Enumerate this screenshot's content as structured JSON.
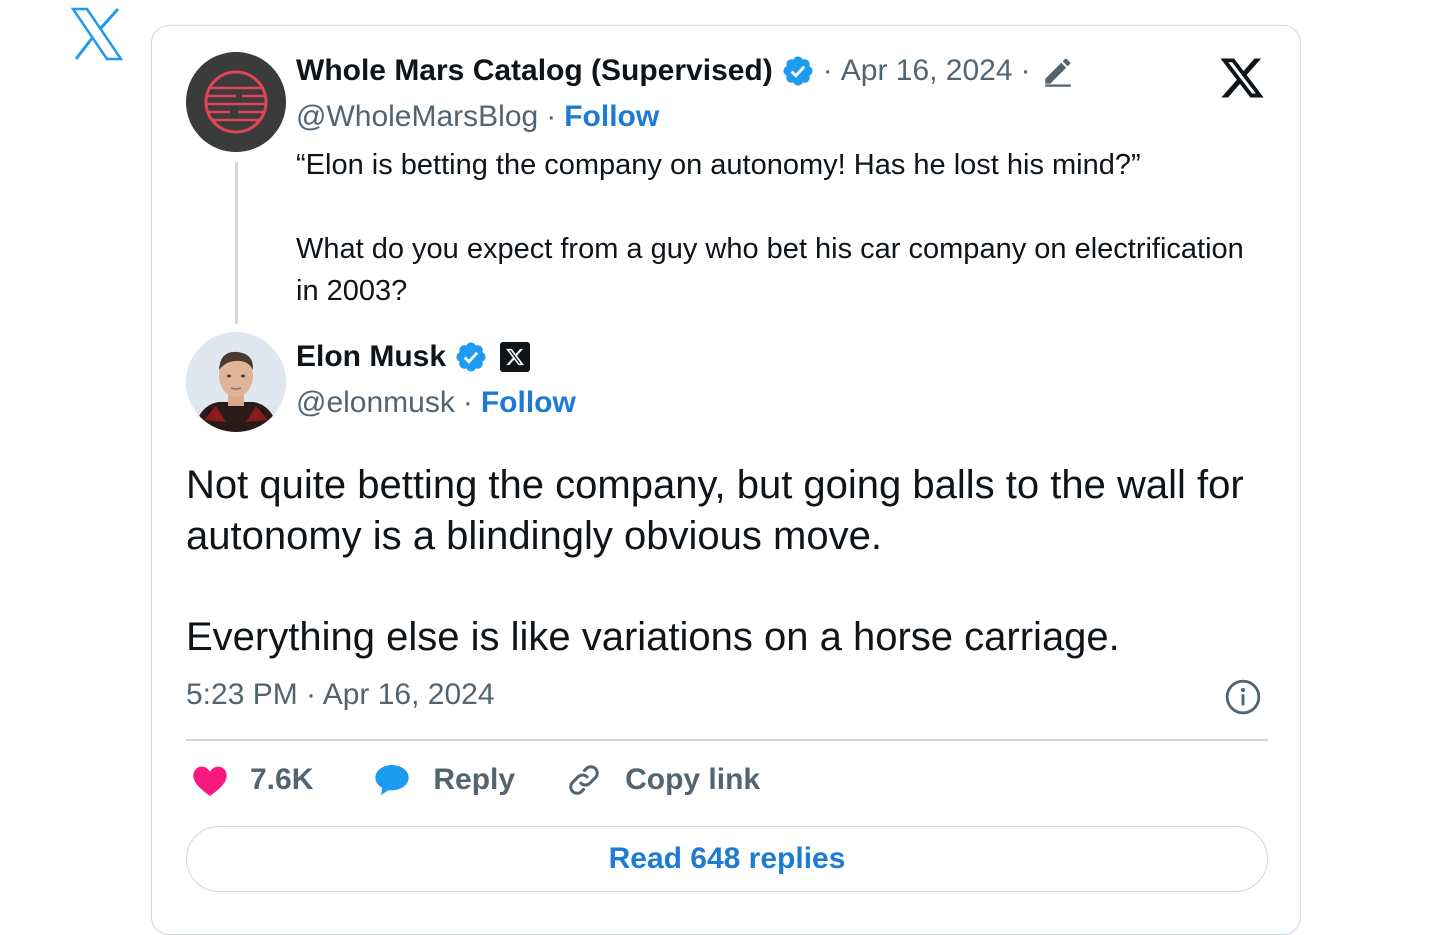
{
  "colors": {
    "link_blue": "#1d7bd4",
    "verified_blue": "#1d9bf0",
    "like_pink": "#f91880",
    "text_primary": "#0f1419",
    "text_secondary": "#536471",
    "border": "#cfd9de"
  },
  "icons": {
    "brand": "x-logo-icon",
    "verified": "verified-badge-icon",
    "edited": "pencil-icon",
    "info": "info-icon",
    "like": "heart-icon",
    "reply": "speech-bubble-icon",
    "copy": "link-icon"
  },
  "quoted_tweet": {
    "author_name": "Whole Mars Catalog (Supervised)",
    "date": "Apr 16, 2024",
    "handle": "@WholeMarsBlog",
    "follow_label": "Follow",
    "text_lines": [
      "“Elon is betting the company on autonomy! Has he lost his mind?”",
      "What do you expect from a guy who bet his car company on electrification in 2003?"
    ]
  },
  "main_tweet": {
    "author_name": "Elon Musk",
    "handle": "@elonmusk",
    "follow_label": "Follow",
    "text_paragraphs": [
      "Not quite betting the company, but going balls to the wall for autonomy is a blindingly obvious move.",
      "Everything else is like variations on a horse carriage."
    ],
    "timestamp": "5:23 PM · Apr 16, 2024"
  },
  "actions": {
    "like_count": "7.6K",
    "reply_label": "Reply",
    "copy_label": "Copy link"
  },
  "read_replies_label": "Read 648 replies"
}
